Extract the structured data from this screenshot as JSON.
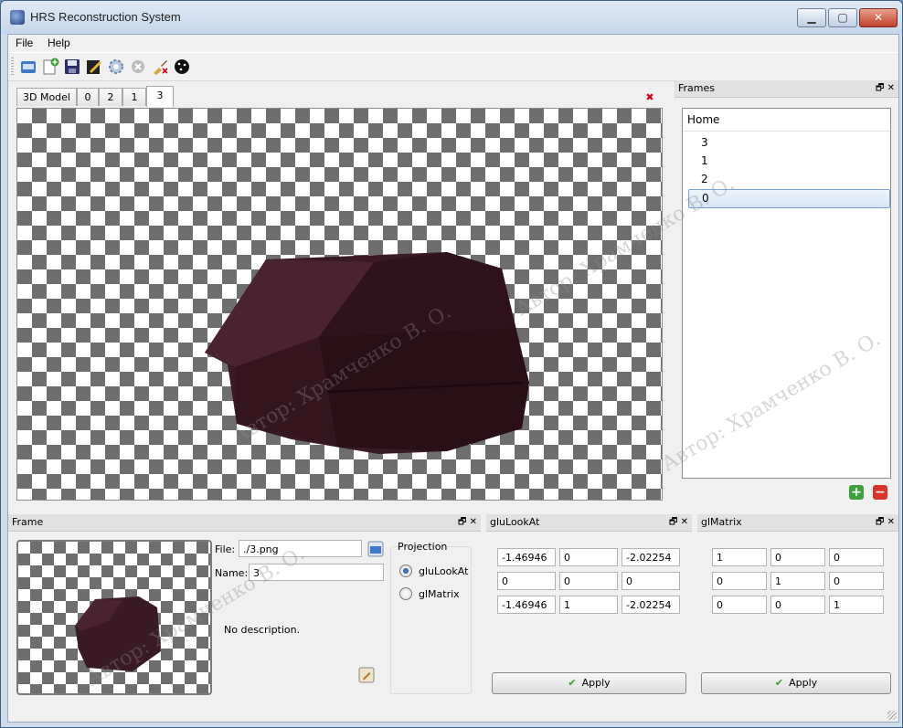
{
  "window": {
    "title": "HRS Reconstruction System"
  },
  "menu": [
    "File",
    "Help"
  ],
  "toolbar": {
    "icons": [
      "open-icon",
      "new-icon",
      "save-icon",
      "edit-icon",
      "settings-icon",
      "stop-icon",
      "brush-icon",
      "dice-icon"
    ]
  },
  "view_tabs": [
    "3D Model",
    "0",
    "2",
    "1",
    "3"
  ],
  "active_tab": "3",
  "frames_panel": {
    "title": "Frames",
    "root": "Home",
    "items": [
      "3",
      "1",
      "2",
      "0"
    ],
    "selected": "0"
  },
  "frame_panel": {
    "title": "Frame",
    "file_label": "File:",
    "file_value": "./3.png",
    "name_label": "Name:",
    "name_value": "3",
    "description": "No description.",
    "projection_title": "Projection",
    "projection_options": [
      "gluLookAt",
      "glMatrix"
    ],
    "projection_selected": "gluLookAt"
  },
  "glulookat_panel": {
    "title": "gluLookAt",
    "values": [
      [
        "-1.46946",
        "0",
        "-2.02254"
      ],
      [
        "0",
        "0",
        "0"
      ],
      [
        "-1.46946",
        "1",
        "-2.02254"
      ]
    ],
    "apply_label": "Apply"
  },
  "glmatrix_panel": {
    "title": "glMatrix",
    "values": [
      [
        "1",
        "0",
        "0"
      ],
      [
        "0",
        "1",
        "0"
      ],
      [
        "0",
        "0",
        "1"
      ]
    ],
    "apply_label": "Apply"
  },
  "watermark": "Автор: Храмченко В. О.",
  "colors": {
    "model": "#3a1a24",
    "checker": "#6e6e6e",
    "accent": "#4a8ad8"
  }
}
